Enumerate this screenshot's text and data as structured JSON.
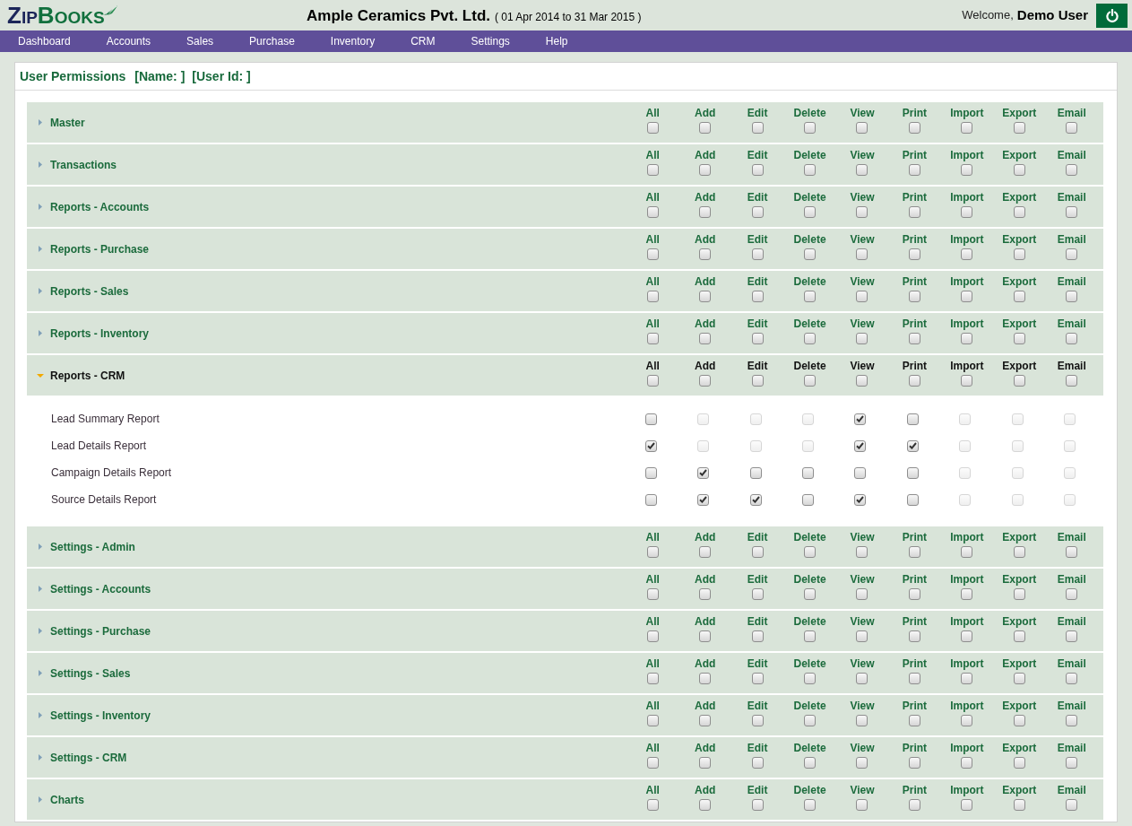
{
  "header": {
    "logo": [
      "ZIP",
      "BOOKS"
    ],
    "company": "Ample Ceramics Pvt. Ltd.",
    "period": "( 01 Apr 2014 to 31 Mar 2015 )",
    "welcome": "Welcome,",
    "user": "Demo User"
  },
  "menu": [
    "Dashboard",
    "Accounts",
    "Sales",
    "Purchase",
    "Inventory",
    "CRM",
    "Settings",
    "Help"
  ],
  "panel": {
    "title": "User Permissions",
    "name": "[Name: ]",
    "user_id": "[User Id: ]",
    "sections": [
      {
        "title": "Master",
        "expanded": false,
        "permissions": [
          {
            "label": "All",
            "checked": false
          },
          {
            "label": "Add",
            "checked": false
          },
          {
            "label": "Edit",
            "checked": false
          },
          {
            "label": "Delete",
            "checked": false
          },
          {
            "label": "View",
            "checked": false
          },
          {
            "label": "Print",
            "checked": false
          },
          {
            "label": "Import",
            "checked": false
          },
          {
            "label": "Export",
            "checked": false
          },
          {
            "label": "Email",
            "checked": false
          }
        ]
      },
      {
        "title": "Transactions",
        "expanded": false,
        "permissions": [
          {
            "label": "All",
            "checked": false
          },
          {
            "label": "Add",
            "checked": false
          },
          {
            "label": "Edit",
            "checked": false
          },
          {
            "label": "Delete",
            "checked": false
          },
          {
            "label": "View",
            "checked": false
          },
          {
            "label": "Print",
            "checked": false
          },
          {
            "label": "Import",
            "checked": false
          },
          {
            "label": "Export",
            "checked": false
          },
          {
            "label": "Email",
            "checked": false
          }
        ]
      },
      {
        "title": "Reports - Accounts",
        "expanded": false,
        "permissions": [
          {
            "label": "All",
            "checked": false
          },
          {
            "label": "Add",
            "checked": false
          },
          {
            "label": "Edit",
            "checked": false
          },
          {
            "label": "Delete",
            "checked": false
          },
          {
            "label": "View",
            "checked": false
          },
          {
            "label": "Print",
            "checked": false
          },
          {
            "label": "Import",
            "checked": false
          },
          {
            "label": "Export",
            "checked": false
          },
          {
            "label": "Email",
            "checked": false
          }
        ]
      },
      {
        "title": "Reports - Purchase",
        "expanded": false,
        "permissions": [
          {
            "label": "All",
            "checked": false
          },
          {
            "label": "Add",
            "checked": false
          },
          {
            "label": "Edit",
            "checked": false
          },
          {
            "label": "Delete",
            "checked": false
          },
          {
            "label": "View",
            "checked": false
          },
          {
            "label": "Print",
            "checked": false
          },
          {
            "label": "Import",
            "checked": false
          },
          {
            "label": "Export",
            "checked": false
          },
          {
            "label": "Email",
            "checked": false
          }
        ]
      },
      {
        "title": "Reports - Sales",
        "expanded": false,
        "permissions": [
          {
            "label": "All",
            "checked": false
          },
          {
            "label": "Add",
            "checked": false
          },
          {
            "label": "Edit",
            "checked": false
          },
          {
            "label": "Delete",
            "checked": false
          },
          {
            "label": "View",
            "checked": false
          },
          {
            "label": "Print",
            "checked": false
          },
          {
            "label": "Import",
            "checked": false
          },
          {
            "label": "Export",
            "checked": false
          },
          {
            "label": "Email",
            "checked": false
          }
        ]
      },
      {
        "title": "Reports - Inventory",
        "expanded": false,
        "permissions": [
          {
            "label": "All",
            "checked": false
          },
          {
            "label": "Add",
            "checked": false
          },
          {
            "label": "Edit",
            "checked": false
          },
          {
            "label": "Delete",
            "checked": false
          },
          {
            "label": "View",
            "checked": false
          },
          {
            "label": "Print",
            "checked": false
          },
          {
            "label": "Import",
            "checked": false
          },
          {
            "label": "Export",
            "checked": false
          },
          {
            "label": "Email",
            "checked": false
          }
        ]
      },
      {
        "title": "Reports - CRM",
        "expanded": true,
        "permissions": [
          {
            "label": "All",
            "checked": false
          },
          {
            "label": "Add",
            "checked": false
          },
          {
            "label": "Edit",
            "checked": false
          },
          {
            "label": "Delete",
            "checked": false
          },
          {
            "label": "View",
            "checked": false
          },
          {
            "label": "Print",
            "checked": false
          },
          {
            "label": "Import",
            "checked": false
          },
          {
            "label": "Export",
            "checked": false
          },
          {
            "label": "Email",
            "checked": false
          }
        ],
        "items": [
          {
            "label": "Lead Summary Report",
            "permissions": [
              {
                "checked": false,
                "disabled": false
              },
              {
                "checked": false,
                "disabled": true
              },
              {
                "checked": false,
                "disabled": true
              },
              {
                "checked": false,
                "disabled": true
              },
              {
                "checked": true,
                "disabled": false
              },
              {
                "checked": false,
                "disabled": false
              },
              {
                "checked": false,
                "disabled": true
              },
              {
                "checked": false,
                "disabled": true
              },
              {
                "checked": false,
                "disabled": true
              }
            ]
          },
          {
            "label": "Lead Details Report",
            "permissions": [
              {
                "checked": true,
                "disabled": false
              },
              {
                "checked": false,
                "disabled": true
              },
              {
                "checked": false,
                "disabled": true
              },
              {
                "checked": false,
                "disabled": true
              },
              {
                "checked": true,
                "disabled": false
              },
              {
                "checked": true,
                "disabled": false
              },
              {
                "checked": false,
                "disabled": true
              },
              {
                "checked": false,
                "disabled": true
              },
              {
                "checked": false,
                "disabled": true
              }
            ]
          },
          {
            "label": "Campaign Details Report",
            "permissions": [
              {
                "checked": false,
                "disabled": false
              },
              {
                "checked": true,
                "disabled": false
              },
              {
                "checked": false,
                "disabled": false
              },
              {
                "checked": false,
                "disabled": false
              },
              {
                "checked": false,
                "disabled": false
              },
              {
                "checked": false,
                "disabled": false
              },
              {
                "checked": false,
                "disabled": true
              },
              {
                "checked": false,
                "disabled": true
              },
              {
                "checked": false,
                "disabled": true
              }
            ]
          },
          {
            "label": "Source Details Report",
            "permissions": [
              {
                "checked": false,
                "disabled": false
              },
              {
                "checked": true,
                "disabled": false
              },
              {
                "checked": true,
                "disabled": false
              },
              {
                "checked": false,
                "disabled": false
              },
              {
                "checked": true,
                "disabled": false
              },
              {
                "checked": false,
                "disabled": false
              },
              {
                "checked": false,
                "disabled": true
              },
              {
                "checked": false,
                "disabled": true
              },
              {
                "checked": false,
                "disabled": true
              }
            ]
          }
        ]
      },
      {
        "title": "Settings - Admin",
        "expanded": false,
        "permissions": [
          {
            "label": "All",
            "checked": false
          },
          {
            "label": "Add",
            "checked": false
          },
          {
            "label": "Edit",
            "checked": false
          },
          {
            "label": "Delete",
            "checked": false
          },
          {
            "label": "View",
            "checked": false
          },
          {
            "label": "Print",
            "checked": false
          },
          {
            "label": "Import",
            "checked": false
          },
          {
            "label": "Export",
            "checked": false
          },
          {
            "label": "Email",
            "checked": false
          }
        ]
      },
      {
        "title": "Settings - Accounts",
        "expanded": false,
        "permissions": [
          {
            "label": "All",
            "checked": false
          },
          {
            "label": "Add",
            "checked": false
          },
          {
            "label": "Edit",
            "checked": false
          },
          {
            "label": "Delete",
            "checked": false
          },
          {
            "label": "View",
            "checked": false
          },
          {
            "label": "Print",
            "checked": false
          },
          {
            "label": "Import",
            "checked": false
          },
          {
            "label": "Export",
            "checked": false
          },
          {
            "label": "Email",
            "checked": false
          }
        ]
      },
      {
        "title": "Settings - Purchase",
        "expanded": false,
        "permissions": [
          {
            "label": "All",
            "checked": false
          },
          {
            "label": "Add",
            "checked": false
          },
          {
            "label": "Edit",
            "checked": false
          },
          {
            "label": "Delete",
            "checked": false
          },
          {
            "label": "View",
            "checked": false
          },
          {
            "label": "Print",
            "checked": false
          },
          {
            "label": "Import",
            "checked": false
          },
          {
            "label": "Export",
            "checked": false
          },
          {
            "label": "Email",
            "checked": false
          }
        ]
      },
      {
        "title": "Settings - Sales",
        "expanded": false,
        "permissions": [
          {
            "label": "All",
            "checked": false
          },
          {
            "label": "Add",
            "checked": false
          },
          {
            "label": "Edit",
            "checked": false
          },
          {
            "label": "Delete",
            "checked": false
          },
          {
            "label": "View",
            "checked": false
          },
          {
            "label": "Print",
            "checked": false
          },
          {
            "label": "Import",
            "checked": false
          },
          {
            "label": "Export",
            "checked": false
          },
          {
            "label": "Email",
            "checked": false
          }
        ]
      },
      {
        "title": "Settings - Inventory",
        "expanded": false,
        "permissions": [
          {
            "label": "All",
            "checked": false
          },
          {
            "label": "Add",
            "checked": false
          },
          {
            "label": "Edit",
            "checked": false
          },
          {
            "label": "Delete",
            "checked": false
          },
          {
            "label": "View",
            "checked": false
          },
          {
            "label": "Print",
            "checked": false
          },
          {
            "label": "Import",
            "checked": false
          },
          {
            "label": "Export",
            "checked": false
          },
          {
            "label": "Email",
            "checked": false
          }
        ]
      },
      {
        "title": "Settings - CRM",
        "expanded": false,
        "permissions": [
          {
            "label": "All",
            "checked": false
          },
          {
            "label": "Add",
            "checked": false
          },
          {
            "label": "Edit",
            "checked": false
          },
          {
            "label": "Delete",
            "checked": false
          },
          {
            "label": "View",
            "checked": false
          },
          {
            "label": "Print",
            "checked": false
          },
          {
            "label": "Import",
            "checked": false
          },
          {
            "label": "Export",
            "checked": false
          },
          {
            "label": "Email",
            "checked": false
          }
        ]
      },
      {
        "title": "Charts",
        "expanded": false,
        "permissions": [
          {
            "label": "All",
            "checked": false
          },
          {
            "label": "Add",
            "checked": false
          },
          {
            "label": "Edit",
            "checked": false
          },
          {
            "label": "Delete",
            "checked": false
          },
          {
            "label": "View",
            "checked": false
          },
          {
            "label": "Print",
            "checked": false
          },
          {
            "label": "Import",
            "checked": false
          },
          {
            "label": "Export",
            "checked": false
          },
          {
            "label": "Email",
            "checked": false
          }
        ]
      }
    ]
  }
}
